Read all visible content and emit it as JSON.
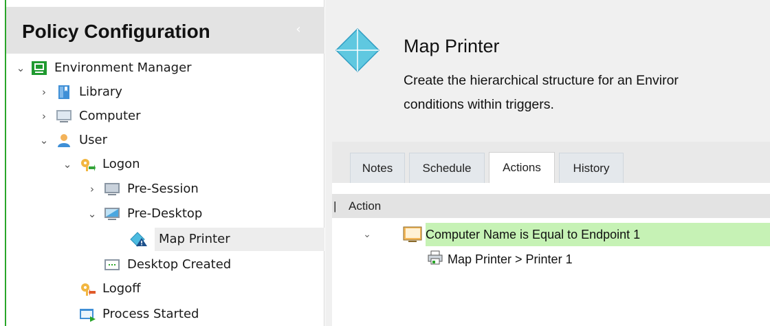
{
  "sidebar": {
    "title": "Policy Configuration",
    "collapse_glyph": "‹",
    "tree": [
      {
        "label": "Environment Manager",
        "icon": "environment-manager-icon",
        "expanded": true
      },
      {
        "label": "Library",
        "icon": "library-icon",
        "expanded": false
      },
      {
        "label": "Computer",
        "icon": "computer-icon",
        "expanded": false
      },
      {
        "label": "User",
        "icon": "user-icon",
        "expanded": true
      },
      {
        "label": "Logon",
        "icon": "logon-key-icon",
        "expanded": true
      },
      {
        "label": "Pre-Session",
        "icon": "pre-session-icon",
        "expanded": false
      },
      {
        "label": "Pre-Desktop",
        "icon": "pre-desktop-icon",
        "expanded": true
      },
      {
        "label": "Map Printer",
        "icon": "map-printer-node-icon",
        "selected": true
      },
      {
        "label": "Desktop Created",
        "icon": "desktop-created-icon"
      },
      {
        "label": "Logoff",
        "icon": "logoff-key-icon"
      },
      {
        "label": "Process Started",
        "icon": "process-started-icon"
      }
    ]
  },
  "main": {
    "title": "Map Printer",
    "description": "Create the hierarchical structure for an Enviro conditions within triggers.",
    "description_line1": "Create the hierarchical structure for an Enviror",
    "description_line2": "conditions within triggers.",
    "tabs": [
      {
        "label": "Notes"
      },
      {
        "label": "Schedule"
      },
      {
        "label": "Actions",
        "active": true
      },
      {
        "label": "History"
      }
    ],
    "column_header": "Action",
    "rows": [
      {
        "label": "Computer Name is Equal to Endpoint 1",
        "type": "condition",
        "expanded": true
      },
      {
        "label": "Map Printer > Printer 1",
        "type": "action"
      }
    ]
  },
  "colors": {
    "accent_green": "#2aa52a",
    "condition_highlight": "#c6f2b5",
    "diamond_fill": "#5fc8e0"
  }
}
